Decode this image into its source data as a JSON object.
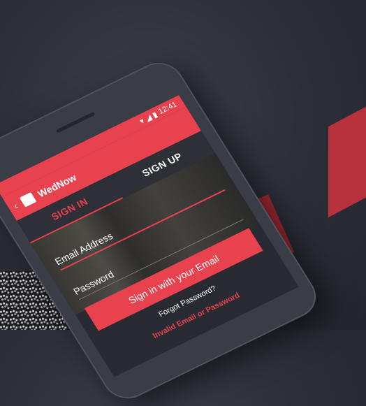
{
  "status": {
    "icons": "▾ ◢ ▮",
    "time": "12:41"
  },
  "appbar": {
    "title": "WedNow"
  },
  "tabs": [
    {
      "label": "SIGN IN"
    },
    {
      "label": "SIGN UP"
    }
  ],
  "form": {
    "email_placeholder": "Email Address",
    "password_placeholder": "Password",
    "submit_label": "Sign in with your Email",
    "forgot_link": "Forgot Password?",
    "error_text": "Invalid Email or Password"
  },
  "colors": {
    "accent": "#e8424f",
    "screen_bg": "#2a2b32",
    "backdrop": "#2c2e37"
  }
}
